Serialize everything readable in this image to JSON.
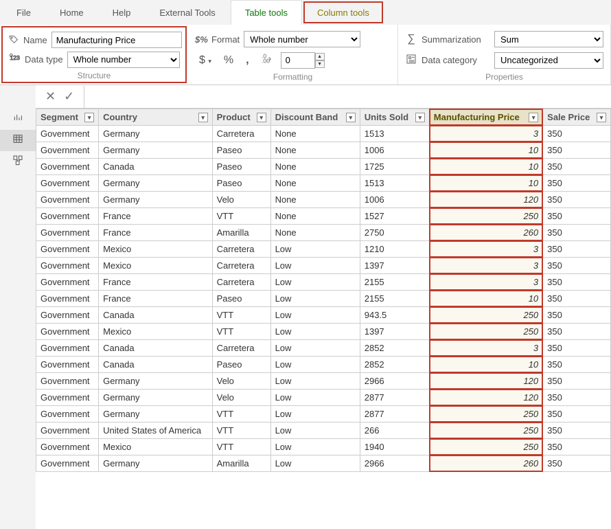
{
  "menubar": {
    "items": [
      "File",
      "Home",
      "Help",
      "External Tools",
      "Table tools",
      "Column tools"
    ]
  },
  "ribbon": {
    "structure": {
      "name_label": "Name",
      "name_value": "Manufacturing Price",
      "datatype_label": "Data type",
      "datatype_value": "Whole number",
      "group_label": "Structure"
    },
    "formatting": {
      "format_label": "Format",
      "format_value": "Whole number",
      "decimal_value": "0",
      "group_label": "Formatting"
    },
    "properties": {
      "summarization_label": "Summarization",
      "summarization_value": "Sum",
      "category_label": "Data category",
      "category_value": "Uncategorized",
      "group_label": "Properties"
    }
  },
  "formula": {
    "value": ""
  },
  "table": {
    "columns": [
      "Segment",
      "Country",
      "Product",
      "Discount Band",
      "Units Sold",
      "Manufacturing Price",
      "Sale Price"
    ],
    "rows": [
      [
        "Government",
        "Germany",
        "Carretera",
        "None",
        "1513",
        "3",
        "350"
      ],
      [
        "Government",
        "Germany",
        "Paseo",
        "None",
        "1006",
        "10",
        "350"
      ],
      [
        "Government",
        "Canada",
        "Paseo",
        "None",
        "1725",
        "10",
        "350"
      ],
      [
        "Government",
        "Germany",
        "Paseo",
        "None",
        "1513",
        "10",
        "350"
      ],
      [
        "Government",
        "Germany",
        "Velo",
        "None",
        "1006",
        "120",
        "350"
      ],
      [
        "Government",
        "France",
        "VTT",
        "None",
        "1527",
        "250",
        "350"
      ],
      [
        "Government",
        "France",
        "Amarilla",
        "None",
        "2750",
        "260",
        "350"
      ],
      [
        "Government",
        "Mexico",
        "Carretera",
        "Low",
        "1210",
        "3",
        "350"
      ],
      [
        "Government",
        "Mexico",
        "Carretera",
        "Low",
        "1397",
        "3",
        "350"
      ],
      [
        "Government",
        "France",
        "Carretera",
        "Low",
        "2155",
        "3",
        "350"
      ],
      [
        "Government",
        "France",
        "Paseo",
        "Low",
        "2155",
        "10",
        "350"
      ],
      [
        "Government",
        "Canada",
        "VTT",
        "Low",
        "943.5",
        "250",
        "350"
      ],
      [
        "Government",
        "Mexico",
        "VTT",
        "Low",
        "1397",
        "250",
        "350"
      ],
      [
        "Government",
        "Canada",
        "Carretera",
        "Low",
        "2852",
        "3",
        "350"
      ],
      [
        "Government",
        "Canada",
        "Paseo",
        "Low",
        "2852",
        "10",
        "350"
      ],
      [
        "Government",
        "Germany",
        "Velo",
        "Low",
        "2966",
        "120",
        "350"
      ],
      [
        "Government",
        "Germany",
        "Velo",
        "Low",
        "2877",
        "120",
        "350"
      ],
      [
        "Government",
        "Germany",
        "VTT",
        "Low",
        "2877",
        "250",
        "350"
      ],
      [
        "Government",
        "United States of America",
        "VTT",
        "Low",
        "266",
        "250",
        "350"
      ],
      [
        "Government",
        "Mexico",
        "VTT",
        "Low",
        "1940",
        "250",
        "350"
      ],
      [
        "Government",
        "Germany",
        "Amarilla",
        "Low",
        "2966",
        "260",
        "350"
      ]
    ]
  }
}
